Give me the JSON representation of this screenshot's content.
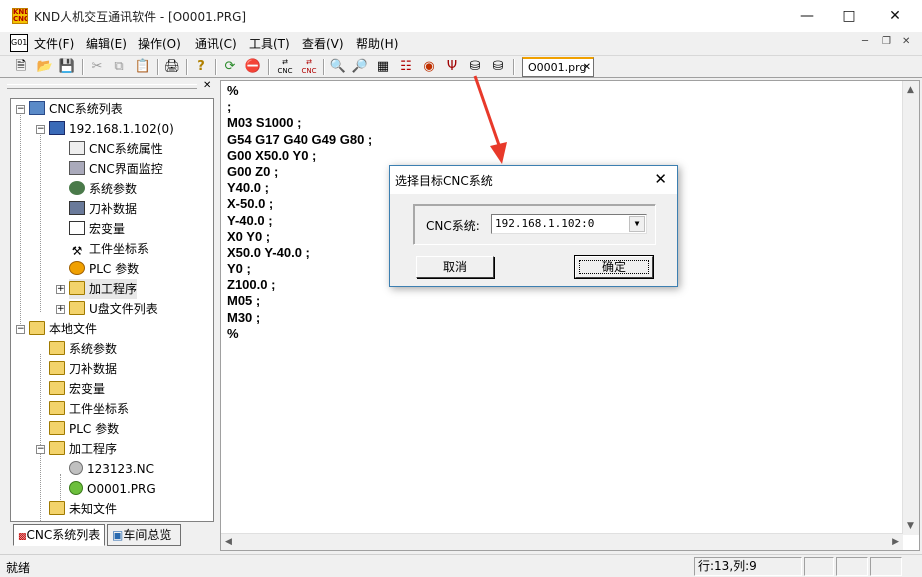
{
  "window": {
    "title": "KND人机交互通讯软件 - [O0001.PRG]",
    "app_icon": "knd-logo-icon",
    "controls": [
      "minimize",
      "maximize",
      "close"
    ]
  },
  "menu": {
    "items": [
      {
        "label": "文件(F)"
      },
      {
        "label": "编辑(E)"
      },
      {
        "label": "操作(O)"
      },
      {
        "label": "通讯(C)"
      },
      {
        "label": "工具(T)"
      },
      {
        "label": "查看(V)"
      },
      {
        "label": "帮助(H)"
      }
    ]
  },
  "toolbar": {
    "icons": [
      "new-file-icon",
      "open-folder-icon",
      "save-icon",
      "cut-icon",
      "copy-icon",
      "paste-icon",
      "print-icon",
      "help-icon",
      "refresh-icon",
      "stop-icon",
      "send-cnc-icon",
      "receive-cnc-icon",
      "find-icon",
      "find-replace-icon",
      "compile-icon",
      "upload-icon",
      "usb-icon",
      "connect-icon",
      "select-cnc-icon"
    ],
    "document_tab": "O0001.prg"
  },
  "tree": {
    "nodes": [
      {
        "label": "CNC系统列表",
        "icon": "network-icon"
      },
      {
        "label": "192.168.1.102(0)",
        "icon": "computer-icon"
      },
      {
        "label": "CNC系统属性",
        "icon": "properties-icon"
      },
      {
        "label": "CNC界面监控",
        "icon": "monitor-icon"
      },
      {
        "label": "系统参数",
        "icon": "parameters-icon"
      },
      {
        "label": "刀补数据",
        "icon": "tool-offset-icon"
      },
      {
        "label": "宏变量",
        "icon": "macro-variable-icon"
      },
      {
        "label": "工件坐标系",
        "icon": "tools-icon"
      },
      {
        "label": "PLC 参数",
        "icon": "plc-icon"
      },
      {
        "label": "加工程序",
        "icon": "folder-icon"
      },
      {
        "label": "U盘文件列表",
        "icon": "folder-icon"
      },
      {
        "label": "本地文件",
        "icon": "folder-open-icon"
      },
      {
        "label": "系统参数",
        "icon": "folder-icon"
      },
      {
        "label": "刀补数据",
        "icon": "folder-icon"
      },
      {
        "label": "宏变量",
        "icon": "folder-icon"
      },
      {
        "label": "工件坐标系",
        "icon": "folder-icon"
      },
      {
        "label": "PLC 参数",
        "icon": "folder-icon"
      },
      {
        "label": "加工程序",
        "icon": "folder-open-icon"
      },
      {
        "label": "123123.NC",
        "icon": "gray-circle-icon"
      },
      {
        "label": "O0001.PRG",
        "icon": "green-circle-icon"
      },
      {
        "label": "未知文件",
        "icon": "folder-icon"
      }
    ]
  },
  "panel_tabs": [
    {
      "label": "CNC系统列表"
    },
    {
      "label": "车间总览"
    }
  ],
  "editor": {
    "lines": [
      "%",
      ";",
      "M03 S1000 ;",
      "G54 G17 G40 G49 G80 ;",
      "G00 X50.0 Y0 ;",
      "G00 Z0 ;",
      "Y40.0 ;",
      "X-50.0 ;",
      "Y-40.0 ;",
      "X0 Y0 ;",
      "X50.0 Y-40.0 ;",
      "Y0 ;",
      "Z100.0 ;",
      "M05 ;",
      "M30 ;",
      "%"
    ]
  },
  "dialog": {
    "title": "选择目标CNC系统",
    "combo_label": "CNC系统:",
    "combo_value": "192.168.1.102:0",
    "cancel_label": "取消",
    "ok_label": "确定"
  },
  "status": {
    "text": "就绪",
    "position": "行:13,列:9"
  },
  "colors": {
    "annotation_arrow": "#e8392a",
    "dialog_border": "#3c7fb1",
    "tab_accent": "#f0a000"
  }
}
